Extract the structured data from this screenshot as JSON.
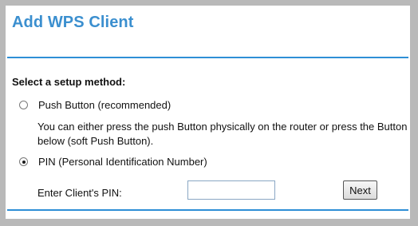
{
  "page": {
    "title": "Add WPS Client",
    "accent_color": "#2e8fd6",
    "title_color": "#3b8fcf"
  },
  "setup": {
    "section_label": "Select a setup method:",
    "options": [
      {
        "label": "Push Button (recommended)",
        "selected": false
      },
      {
        "label": "PIN (Personal Identification Number)",
        "selected": true
      }
    ],
    "push_help": "You can either press the push Button physically on the router or press the Button below (soft Push Button)."
  },
  "pin": {
    "label": "Enter Client's PIN:",
    "value": "",
    "next_label": "Next"
  }
}
